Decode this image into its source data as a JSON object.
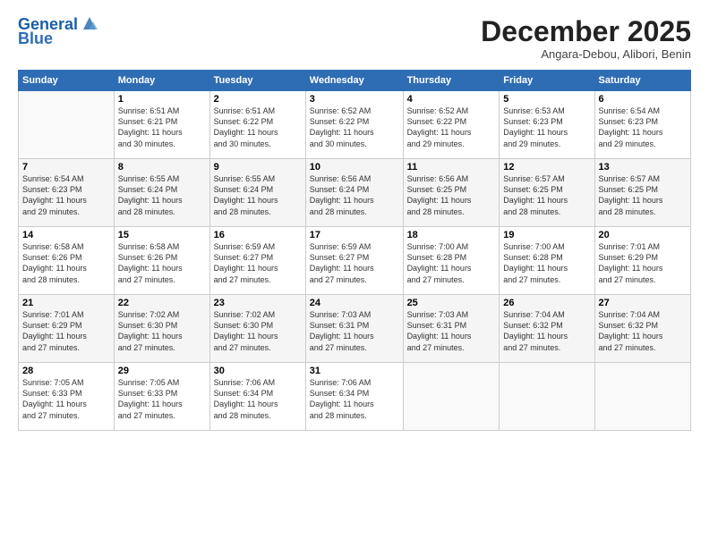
{
  "logo": {
    "line1": "General",
    "line2": "Blue"
  },
  "title": "December 2025",
  "subtitle": "Angara-Debou, Alibori, Benin",
  "header_days": [
    "Sunday",
    "Monday",
    "Tuesday",
    "Wednesday",
    "Thursday",
    "Friday",
    "Saturday"
  ],
  "weeks": [
    [
      {
        "day": "",
        "info": ""
      },
      {
        "day": "1",
        "info": "Sunrise: 6:51 AM\nSunset: 6:21 PM\nDaylight: 11 hours\nand 30 minutes."
      },
      {
        "day": "2",
        "info": "Sunrise: 6:51 AM\nSunset: 6:22 PM\nDaylight: 11 hours\nand 30 minutes."
      },
      {
        "day": "3",
        "info": "Sunrise: 6:52 AM\nSunset: 6:22 PM\nDaylight: 11 hours\nand 30 minutes."
      },
      {
        "day": "4",
        "info": "Sunrise: 6:52 AM\nSunset: 6:22 PM\nDaylight: 11 hours\nand 29 minutes."
      },
      {
        "day": "5",
        "info": "Sunrise: 6:53 AM\nSunset: 6:23 PM\nDaylight: 11 hours\nand 29 minutes."
      },
      {
        "day": "6",
        "info": "Sunrise: 6:54 AM\nSunset: 6:23 PM\nDaylight: 11 hours\nand 29 minutes."
      }
    ],
    [
      {
        "day": "7",
        "info": "Sunrise: 6:54 AM\nSunset: 6:23 PM\nDaylight: 11 hours\nand 29 minutes."
      },
      {
        "day": "8",
        "info": "Sunrise: 6:55 AM\nSunset: 6:24 PM\nDaylight: 11 hours\nand 28 minutes."
      },
      {
        "day": "9",
        "info": "Sunrise: 6:55 AM\nSunset: 6:24 PM\nDaylight: 11 hours\nand 28 minutes."
      },
      {
        "day": "10",
        "info": "Sunrise: 6:56 AM\nSunset: 6:24 PM\nDaylight: 11 hours\nand 28 minutes."
      },
      {
        "day": "11",
        "info": "Sunrise: 6:56 AM\nSunset: 6:25 PM\nDaylight: 11 hours\nand 28 minutes."
      },
      {
        "day": "12",
        "info": "Sunrise: 6:57 AM\nSunset: 6:25 PM\nDaylight: 11 hours\nand 28 minutes."
      },
      {
        "day": "13",
        "info": "Sunrise: 6:57 AM\nSunset: 6:25 PM\nDaylight: 11 hours\nand 28 minutes."
      }
    ],
    [
      {
        "day": "14",
        "info": "Sunrise: 6:58 AM\nSunset: 6:26 PM\nDaylight: 11 hours\nand 28 minutes."
      },
      {
        "day": "15",
        "info": "Sunrise: 6:58 AM\nSunset: 6:26 PM\nDaylight: 11 hours\nand 27 minutes."
      },
      {
        "day": "16",
        "info": "Sunrise: 6:59 AM\nSunset: 6:27 PM\nDaylight: 11 hours\nand 27 minutes."
      },
      {
        "day": "17",
        "info": "Sunrise: 6:59 AM\nSunset: 6:27 PM\nDaylight: 11 hours\nand 27 minutes."
      },
      {
        "day": "18",
        "info": "Sunrise: 7:00 AM\nSunset: 6:28 PM\nDaylight: 11 hours\nand 27 minutes."
      },
      {
        "day": "19",
        "info": "Sunrise: 7:00 AM\nSunset: 6:28 PM\nDaylight: 11 hours\nand 27 minutes."
      },
      {
        "day": "20",
        "info": "Sunrise: 7:01 AM\nSunset: 6:29 PM\nDaylight: 11 hours\nand 27 minutes."
      }
    ],
    [
      {
        "day": "21",
        "info": "Sunrise: 7:01 AM\nSunset: 6:29 PM\nDaylight: 11 hours\nand 27 minutes."
      },
      {
        "day": "22",
        "info": "Sunrise: 7:02 AM\nSunset: 6:30 PM\nDaylight: 11 hours\nand 27 minutes."
      },
      {
        "day": "23",
        "info": "Sunrise: 7:02 AM\nSunset: 6:30 PM\nDaylight: 11 hours\nand 27 minutes."
      },
      {
        "day": "24",
        "info": "Sunrise: 7:03 AM\nSunset: 6:31 PM\nDaylight: 11 hours\nand 27 minutes."
      },
      {
        "day": "25",
        "info": "Sunrise: 7:03 AM\nSunset: 6:31 PM\nDaylight: 11 hours\nand 27 minutes."
      },
      {
        "day": "26",
        "info": "Sunrise: 7:04 AM\nSunset: 6:32 PM\nDaylight: 11 hours\nand 27 minutes."
      },
      {
        "day": "27",
        "info": "Sunrise: 7:04 AM\nSunset: 6:32 PM\nDaylight: 11 hours\nand 27 minutes."
      }
    ],
    [
      {
        "day": "28",
        "info": "Sunrise: 7:05 AM\nSunset: 6:33 PM\nDaylight: 11 hours\nand 27 minutes."
      },
      {
        "day": "29",
        "info": "Sunrise: 7:05 AM\nSunset: 6:33 PM\nDaylight: 11 hours\nand 27 minutes."
      },
      {
        "day": "30",
        "info": "Sunrise: 7:06 AM\nSunset: 6:34 PM\nDaylight: 11 hours\nand 28 minutes."
      },
      {
        "day": "31",
        "info": "Sunrise: 7:06 AM\nSunset: 6:34 PM\nDaylight: 11 hours\nand 28 minutes."
      },
      {
        "day": "",
        "info": ""
      },
      {
        "day": "",
        "info": ""
      },
      {
        "day": "",
        "info": ""
      }
    ]
  ]
}
